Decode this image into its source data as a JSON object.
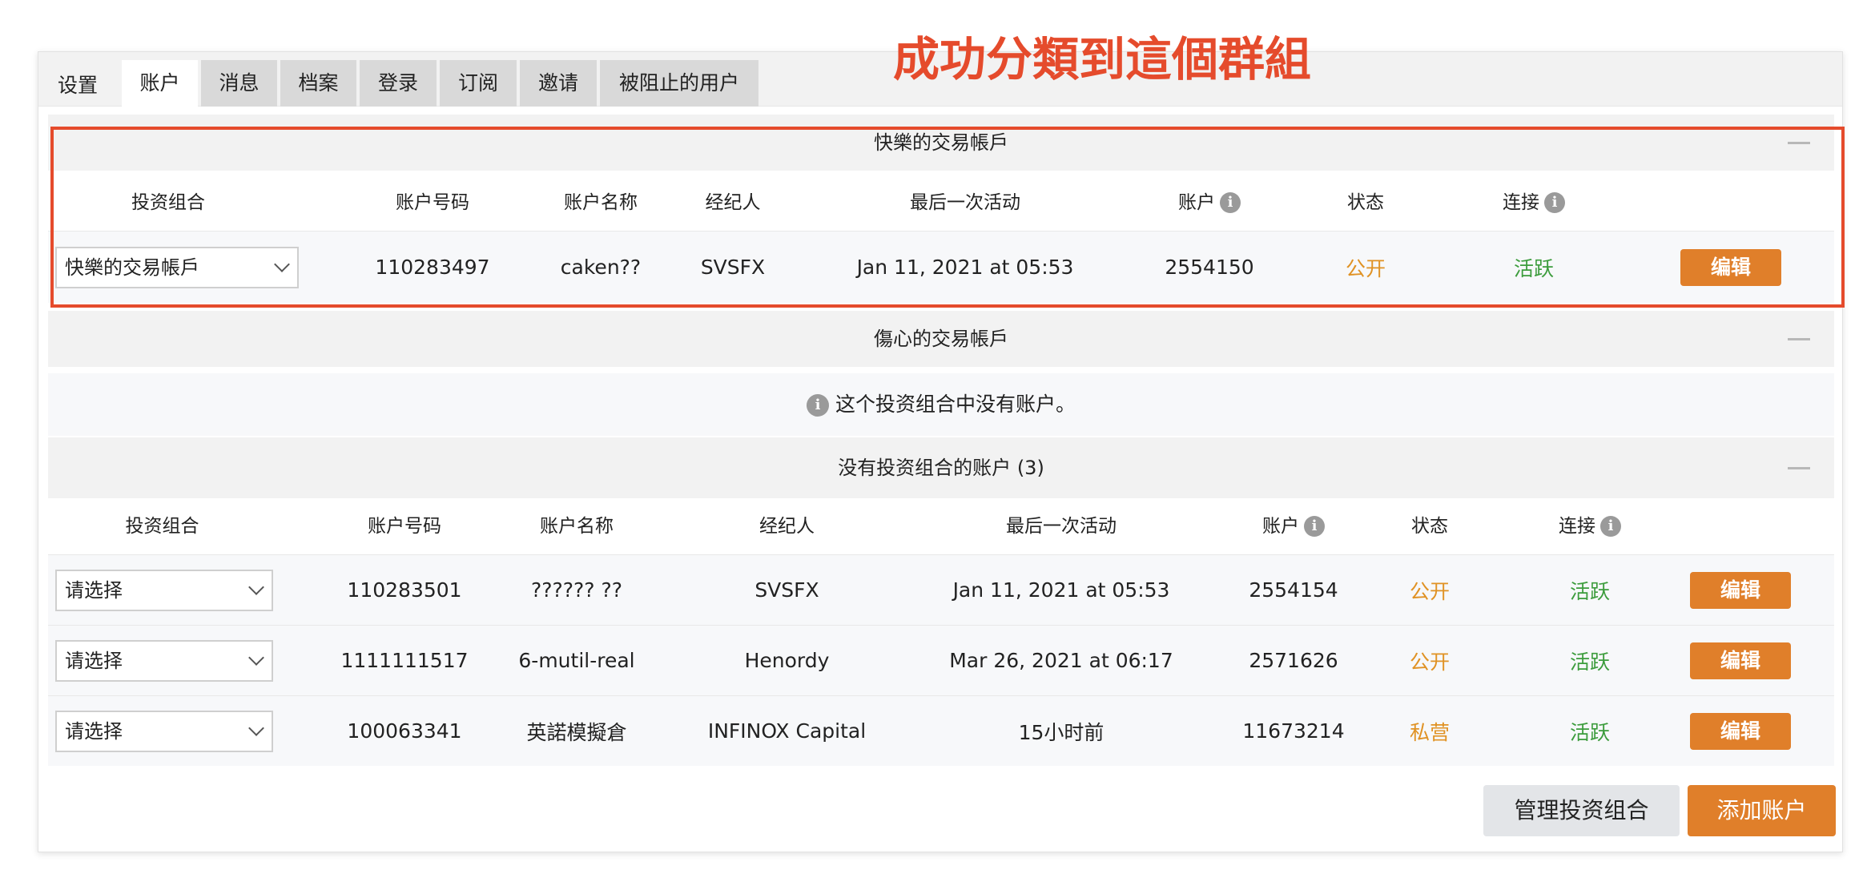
{
  "banner": "成功分類到這個群組",
  "tabs": {
    "settings": "设置",
    "items": [
      {
        "label": "账户",
        "active": true
      },
      {
        "label": "消息",
        "active": false
      },
      {
        "label": "档案",
        "active": false
      },
      {
        "label": "登录",
        "active": false
      },
      {
        "label": "订阅",
        "active": false
      },
      {
        "label": "邀请",
        "active": false
      },
      {
        "label": "被阻止的用户",
        "active": false
      }
    ]
  },
  "columns": {
    "portfolio": "投资组合",
    "account_number": "账户号码",
    "account_name": "账户名称",
    "broker": "经纪人",
    "last_activity": "最后一次活动",
    "account": "账户",
    "status": "状态",
    "connection": "连接"
  },
  "groups": [
    {
      "title": "快樂的交易帳戶",
      "rows": [
        {
          "portfolio": "快樂的交易帳戶",
          "number": "110283497",
          "name": "caken??",
          "broker": "SVSFX",
          "last_activity": "Jan 11, 2021 at 05:53",
          "account": "2554150",
          "status": "公开",
          "connection": "活跃",
          "edit": "编辑"
        }
      ]
    },
    {
      "title": "傷心的交易帳戶",
      "empty_message": "这个投资组合中没有账户。"
    },
    {
      "title": "没有投资组合的账户 (3)",
      "rows": [
        {
          "portfolio": "请选择",
          "number": "110283501",
          "name": "?????? ??",
          "broker": "SVSFX",
          "last_activity": "Jan 11, 2021 at 05:53",
          "account": "2554154",
          "status": "公开",
          "connection": "活跃",
          "edit": "编辑"
        },
        {
          "portfolio": "请选择",
          "number": "1111111517",
          "name": "6-mutil-real",
          "broker": "Henordy",
          "last_activity": "Mar 26, 2021 at 06:17",
          "account": "2571626",
          "status": "公开",
          "connection": "活跃",
          "edit": "编辑"
        },
        {
          "portfolio": "请选择",
          "number": "100063341",
          "name": "英諾模擬倉",
          "broker": "INFINOX Capital",
          "last_activity": "15小时前",
          "account": "11673214",
          "status": "私营",
          "connection": "活跃",
          "edit": "编辑"
        }
      ]
    }
  ],
  "actions": {
    "manage_portfolio": "管理投资组合",
    "add_account": "添加账户"
  },
  "colors": {
    "accent": "#e07f2a",
    "banner": "#e54b2c",
    "status": "#e09224",
    "active": "#3c9c3c"
  },
  "icons": {
    "info": "info-icon",
    "collapse": "minus-icon",
    "dropdown": "chevron-down-icon"
  }
}
